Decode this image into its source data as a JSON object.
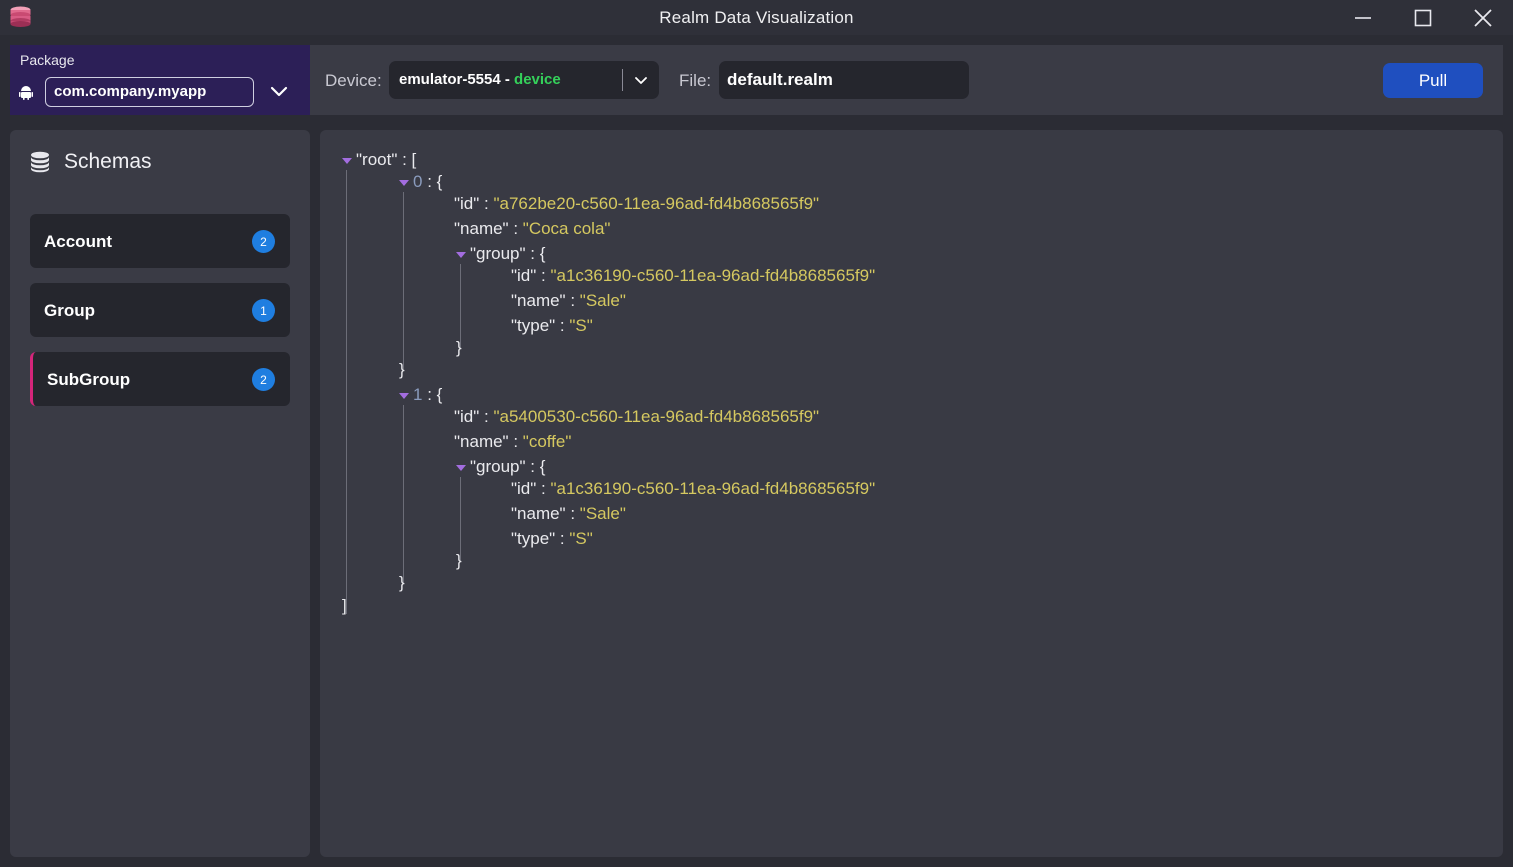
{
  "window": {
    "title": "Realm Data Visualization"
  },
  "package": {
    "label": "Package",
    "value": "com.company.myapp"
  },
  "toolbar": {
    "device_label": "Device:",
    "device_name": "emulator-5554 -",
    "device_type": "device",
    "file_label": "File:",
    "file_value": "default.realm",
    "pull_label": "Pull"
  },
  "sidebar": {
    "title": "Schemas",
    "items": [
      {
        "label": "Account",
        "count": "2"
      },
      {
        "label": "Group",
        "count": "1"
      },
      {
        "label": "SubGroup",
        "count": "2"
      }
    ]
  },
  "json_view": {
    "root_key": "\"root\"",
    "records": [
      {
        "index": "0",
        "id": "\"a762be20-c560-11ea-96ad-fd4b868565f9\"",
        "name": "\"Coca cola\"",
        "group": {
          "id": "\"a1c36190-c560-11ea-96ad-fd4b868565f9\"",
          "name": "\"Sale\"",
          "type": "\"S\""
        }
      },
      {
        "index": "1",
        "id": "\"a5400530-c560-11ea-96ad-fd4b868565f9\"",
        "name": "\"coffe\"",
        "group": {
          "id": "\"a1c36190-c560-11ea-96ad-fd4b868565f9\"",
          "name": "\"Sale\"",
          "type": "\"S\""
        }
      }
    ],
    "keys": {
      "id": "\"id\"",
      "name": "\"name\"",
      "group": "\"group\"",
      "type": "\"type\""
    }
  },
  "colors": {
    "accent": "#1f4fbf",
    "badge": "#1f7ee0",
    "active_marker": "#d4257a",
    "string_value": "#d5c860",
    "device_status": "#35d05a"
  }
}
